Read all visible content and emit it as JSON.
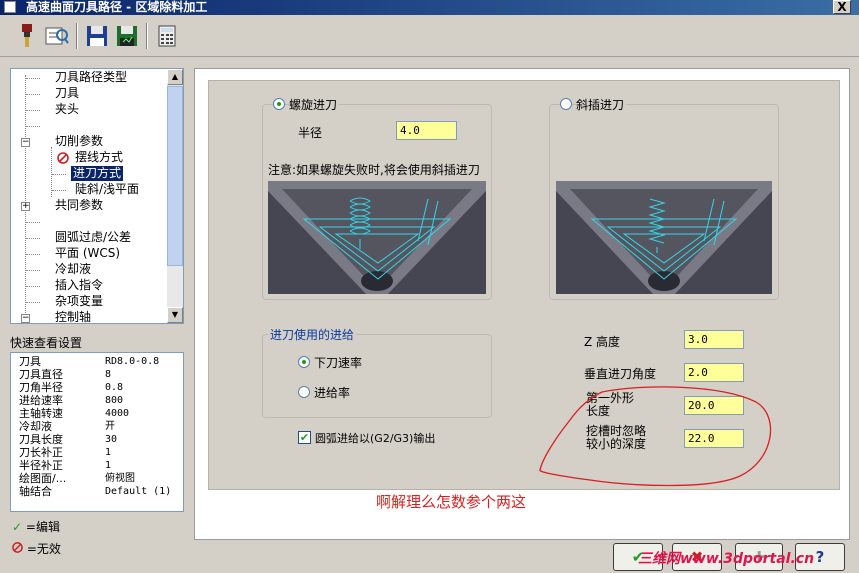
{
  "window": {
    "title": "高速曲面刀具路径 - 区域除料加工",
    "close_glyph": "X"
  },
  "toolbar": {
    "icons": [
      "tool-icon",
      "tool-list-icon",
      "save-icon",
      "save-all-icon",
      "calculator-icon"
    ]
  },
  "tree": {
    "items": [
      {
        "label": "刀具路径类型"
      },
      {
        "label": "刀具"
      },
      {
        "label": "夹头"
      },
      {
        "label": ""
      },
      {
        "label": "切削参数"
      },
      {
        "label": "摆线方式"
      },
      {
        "label": "进刀方式"
      },
      {
        "label": "陡斜/浅平面"
      },
      {
        "label": "共同参数"
      },
      {
        "label": ""
      },
      {
        "label": "圆弧过虑/公差"
      },
      {
        "label": "平面 (WCS)"
      },
      {
        "label": "冷却液"
      },
      {
        "label": "插入指令"
      },
      {
        "label": "杂项变量"
      },
      {
        "label": "控制轴"
      }
    ]
  },
  "quick_view": {
    "title": "快速查看设置",
    "rows": [
      {
        "k": "刀具",
        "v": "RD8.0-0.8"
      },
      {
        "k": "刀具直径",
        "v": "8"
      },
      {
        "k": "刀角半径",
        "v": "0.8"
      },
      {
        "k": "进给速率",
        "v": "800"
      },
      {
        "k": "主轴转速",
        "v": "4000"
      },
      {
        "k": "冷却液",
        "v": "开"
      },
      {
        "k": "刀具长度",
        "v": "30"
      },
      {
        "k": "刀长补正",
        "v": "1"
      },
      {
        "k": "半径补正",
        "v": "1"
      },
      {
        "k": "绘图面/...",
        "v": "俯视图"
      },
      {
        "k": "轴结合",
        "v": "Default (1)"
      }
    ]
  },
  "legend": {
    "edit": "=编辑",
    "invalid": "=无效"
  },
  "helix": {
    "label": "螺旋进刀",
    "radius_label": "半径",
    "radius_value": "4.0",
    "note": "注意:如果螺旋失败时,将会使用斜插进刀"
  },
  "ramp": {
    "label": "斜插进刀"
  },
  "feed_group": {
    "title": "进刀使用的进给",
    "option1": "下刀速率",
    "option2": "进给率"
  },
  "arc_output": {
    "label": "圆弧进给以(G2/G3)输出"
  },
  "params": {
    "z_height_label": "Z 高度",
    "z_height_value": "3.0",
    "vert_angle_label": "垂直进刀角度",
    "vert_angle_value": "2.0",
    "first_outer_line1": "第一外形",
    "first_outer_line2": "长度",
    "first_outer_value": "20.0",
    "ignore_line1": "挖槽时忽略",
    "ignore_line2": "较小的深度",
    "ignore_value": "22.0"
  },
  "annotation": "啊解理么怎数参个两这",
  "watermark": "三维网www.3dportal.cn",
  "colors": {
    "field_bg": "#ffff99",
    "annotation": "#d91f1f",
    "selection": "#0a246a",
    "toolpath": "#33d6e8"
  }
}
